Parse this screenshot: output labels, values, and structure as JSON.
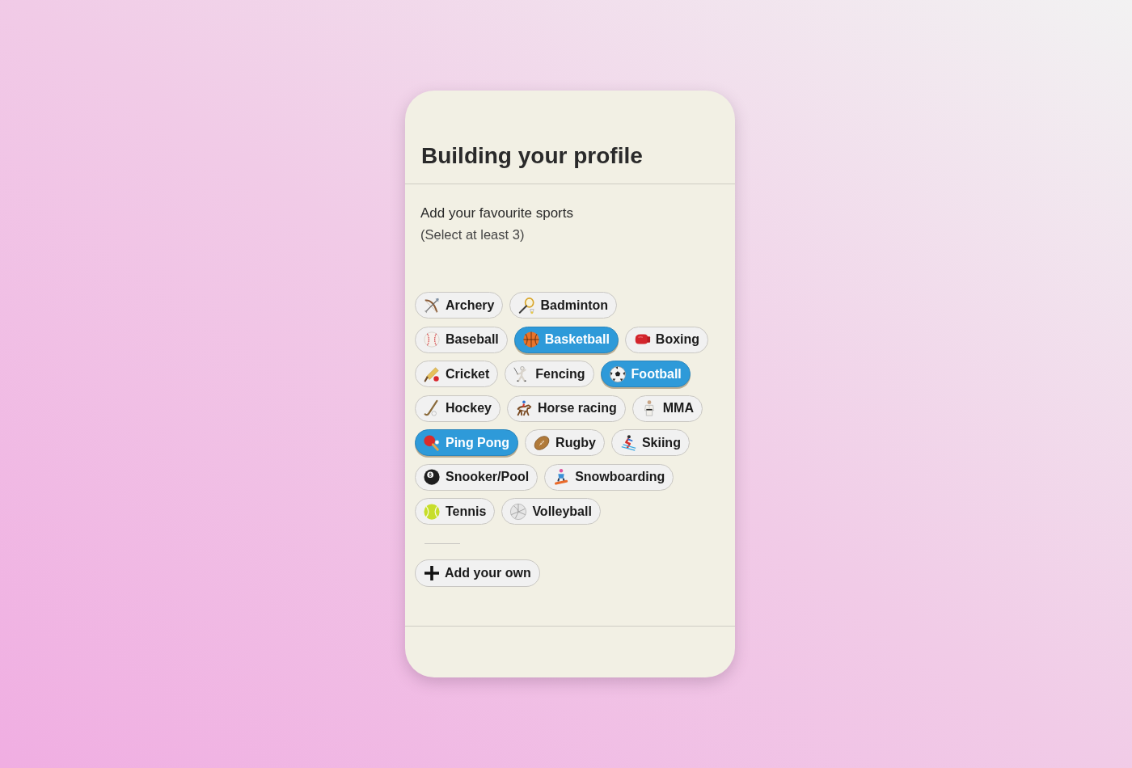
{
  "header": {
    "title": "Building your profile"
  },
  "prompt": {
    "heading": "Add your favourite sports",
    "hint": "(Select at least 3)"
  },
  "sport_rows": [
    [
      {
        "label": "Archery",
        "selected": false
      },
      {
        "label": "Badminton",
        "selected": false
      }
    ],
    [
      {
        "label": "Baseball",
        "selected": false
      },
      {
        "label": "Basketball",
        "selected": true
      },
      {
        "label": "Boxing",
        "selected": false
      }
    ],
    [
      {
        "label": "Cricket",
        "selected": false
      },
      {
        "label": "Fencing",
        "selected": false
      },
      {
        "label": "Football",
        "selected": true
      }
    ],
    [
      {
        "label": "Hockey",
        "selected": false
      },
      {
        "label": "Horse racing",
        "selected": false
      },
      {
        "label": "MMA",
        "selected": false
      }
    ],
    [
      {
        "label": "Ping Pong",
        "selected": true
      },
      {
        "label": "Rugby",
        "selected": false
      },
      {
        "label": "Skiing",
        "selected": false
      }
    ],
    [
      {
        "label": "Snooker/Pool",
        "selected": false
      },
      {
        "label": "Snowboarding",
        "selected": false
      }
    ],
    [
      {
        "label": "Tennis",
        "selected": false
      },
      {
        "label": "Volleyball",
        "selected": false
      }
    ]
  ],
  "add_button": {
    "label": "Add your own"
  }
}
